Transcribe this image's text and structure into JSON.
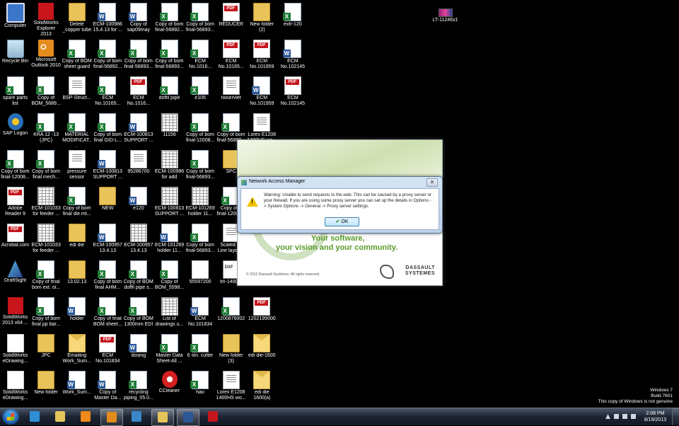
{
  "desktop": {
    "icons": [
      {
        "label": "Computer",
        "kind": "computer",
        "col": 0,
        "row": 0
      },
      {
        "label": "Recycle Bin",
        "kind": "recycle",
        "col": 0,
        "row": 1
      },
      {
        "label": "spare parts list",
        "kind": "excel",
        "col": 0,
        "row": 2
      },
      {
        "label": "SAP Logon",
        "kind": "sap",
        "col": 0,
        "row": 3
      },
      {
        "label": "Copy of bom final-12008...",
        "kind": "excel",
        "col": 0,
        "row": 4
      },
      {
        "label": "Adobe Reader 9",
        "kind": "pdf",
        "col": 0,
        "row": 5
      },
      {
        "label": "Acrobat.com",
        "kind": "pdf",
        "col": 0,
        "row": 6
      },
      {
        "label": "DraftSight",
        "kind": "draft",
        "col": 0,
        "row": 7
      },
      {
        "label": "SolidWorks 2013 x64 ...",
        "kind": "sw",
        "col": 0,
        "row": 8
      },
      {
        "label": "SolidWorks eDrawing...",
        "kind": "edraw",
        "col": 0,
        "row": 9
      },
      {
        "label": "SolidWorks eDrawing...",
        "kind": "edraw",
        "col": 0,
        "row": 10
      },
      {
        "label": "SolidWorks Explorer 2013",
        "kind": "sw",
        "col": 1,
        "row": 0
      },
      {
        "label": "Microsoft Outlook 2010",
        "kind": "outlook",
        "col": 1,
        "row": 1
      },
      {
        "label": "Copy of BOM_5689...",
        "kind": "excel",
        "col": 1,
        "row": 2
      },
      {
        "label": "KRA 12 -13 (JPC)",
        "kind": "excel",
        "col": 1,
        "row": 3
      },
      {
        "label": "Copy of bom final mech...",
        "kind": "excel",
        "col": 1,
        "row": 4
      },
      {
        "label": "ECM-101033 for feeder ...",
        "kind": "table",
        "col": 1,
        "row": 5
      },
      {
        "label": "ECM-101033 for feeder ...",
        "kind": "table",
        "col": 1,
        "row": 6
      },
      {
        "label": "Copy of final bom ext. oi...",
        "kind": "excel",
        "col": 1,
        "row": 7
      },
      {
        "label": "Copy of bom final pp bar...",
        "kind": "excel",
        "col": 1,
        "row": 8
      },
      {
        "label": "JPC",
        "kind": "folder",
        "col": 1,
        "row": 9
      },
      {
        "label": "New folder",
        "kind": "folder",
        "col": 1,
        "row": 10
      },
      {
        "label": "Delete _copper tube",
        "kind": "folder",
        "col": 2,
        "row": 0
      },
      {
        "label": "Copy of BOM sheet guard",
        "kind": "excel",
        "col": 2,
        "row": 1
      },
      {
        "label": "BSP-Struct...",
        "kind": "doc",
        "col": 2,
        "row": 2
      },
      {
        "label": "MATERIAL MODIFICAT...",
        "kind": "excel",
        "col": 2,
        "row": 3
      },
      {
        "label": "pressure sensor",
        "kind": "doc",
        "col": 2,
        "row": 4
      },
      {
        "label": "Copy of bom final die mt...",
        "kind": "excel",
        "col": 2,
        "row": 5
      },
      {
        "label": "edi die",
        "kind": "folder",
        "col": 2,
        "row": 6
      },
      {
        "label": "13.02.13",
        "kind": "folder",
        "col": 2,
        "row": 7
      },
      {
        "label": "holder",
        "kind": "word",
        "col": 2,
        "row": 8
      },
      {
        "label": "Emailing Work_Sum...",
        "kind": "envelope",
        "col": 2,
        "row": 9
      },
      {
        "label": "Work_Sum...",
        "kind": "word",
        "col": 2,
        "row": 10
      },
      {
        "label": "ECM-100986 15.4.13 for ...",
        "kind": "word",
        "col": 3,
        "row": 0
      },
      {
        "label": "Copy of bom final-56892...",
        "kind": "excel",
        "col": 3,
        "row": 1
      },
      {
        "label": "ECM No.10165...",
        "kind": "excel",
        "col": 3,
        "row": 2
      },
      {
        "label": "Copy of bom final GID-L...",
        "kind": "excel",
        "col": 3,
        "row": 3
      },
      {
        "label": "ECM-100813 SUPPORT ...",
        "kind": "word",
        "col": 3,
        "row": 4
      },
      {
        "label": "NEW",
        "kind": "folder",
        "col": 3,
        "row": 5
      },
      {
        "label": "ECM-100957 13.4.13",
        "kind": "word",
        "col": 3,
        "row": 6
      },
      {
        "label": "Copy of bom final AHM...",
        "kind": "excel",
        "col": 3,
        "row": 7
      },
      {
        "label": "Copy of final BOM sheet...",
        "kind": "excel",
        "col": 3,
        "row": 8
      },
      {
        "label": "ECM No.101834",
        "kind": "pdf",
        "col": 3,
        "row": 9
      },
      {
        "label": "Copy of Master Da...",
        "kind": "word",
        "col": 3,
        "row": 10
      },
      {
        "label": "Copy of sap09may",
        "kind": "word",
        "col": 4,
        "row": 0
      },
      {
        "label": "Copy of bom final-56893...",
        "kind": "excel",
        "col": 4,
        "row": 1
      },
      {
        "label": "ECM No.1016...",
        "kind": "pdf",
        "col": 4,
        "row": 2
      },
      {
        "label": "ECM-100813 SUPPORT ...",
        "kind": "word",
        "col": 4,
        "row": 3
      },
      {
        "label": "95286700",
        "kind": "doc",
        "col": 4,
        "row": 4
      },
      {
        "label": "e120",
        "kind": "word",
        "col": 4,
        "row": 5
      },
      {
        "label": "ECM-100957 13.4.13",
        "kind": "table",
        "col": 4,
        "row": 6
      },
      {
        "label": "Copy of BOM doffil pipe s...",
        "kind": "excel",
        "col": 4,
        "row": 7
      },
      {
        "label": "Copy of BOM 1300mm EDI",
        "kind": "excel",
        "col": 4,
        "row": 8
      },
      {
        "label": "dosing",
        "kind": "word",
        "col": 4,
        "row": 9
      },
      {
        "label": "recycling piping_05.0...",
        "kind": "excel",
        "col": 4,
        "row": 10
      },
      {
        "label": "Copy of bom final-56892...",
        "kind": "excel",
        "col": 5,
        "row": 0
      },
      {
        "label": "Copy of bom final-56893...",
        "kind": "excel",
        "col": 5,
        "row": 1
      },
      {
        "label": "doffil pipe",
        "kind": "excel",
        "col": 5,
        "row": 2
      },
      {
        "label": "11156",
        "kind": "table",
        "col": 5,
        "row": 3
      },
      {
        "label": "ECM-100986 for add",
        "kind": "table",
        "col": 5,
        "row": 4
      },
      {
        "label": "ECM-100813 SUPPORT ...",
        "kind": "table",
        "col": 5,
        "row": 5
      },
      {
        "label": "ECM-101269 holder 11...",
        "kind": "word",
        "col": 5,
        "row": 6
      },
      {
        "label": "Copy of BOM_5598...",
        "kind": "excel",
        "col": 5,
        "row": 7
      },
      {
        "label": "List of drawings u...",
        "kind": "table",
        "col": 5,
        "row": 8
      },
      {
        "label": "Master Data Sheet-All ...",
        "kind": "excel",
        "col": 5,
        "row": 9
      },
      {
        "label": "CCleaner",
        "kind": "ccleaner",
        "col": 5,
        "row": 10
      },
      {
        "label": "Copy of bom final-56893...",
        "kind": "excel",
        "col": 6,
        "row": 0
      },
      {
        "label": "ECM No.1016...",
        "kind": "excel",
        "col": 6,
        "row": 1
      },
      {
        "label": "e105",
        "kind": "excel",
        "col": 6,
        "row": 2
      },
      {
        "label": "Copy of bom final-12008...",
        "kind": "excel",
        "col": 6,
        "row": 3
      },
      {
        "label": "Copy of bom final-56893...",
        "kind": "excel",
        "col": 6,
        "row": 4
      },
      {
        "label": "ECM-101269 holder 11...",
        "kind": "table",
        "col": 6,
        "row": 5
      },
      {
        "label": "Copy of bom final-56893...",
        "kind": "excel",
        "col": 6,
        "row": 6
      },
      {
        "label": "55597200",
        "kind": "blank",
        "col": 6,
        "row": 7
      },
      {
        "label": "ECM No.101834",
        "kind": "word",
        "col": 6,
        "row": 8
      },
      {
        "label": "6 stn. cutter",
        "kind": "excel",
        "col": 6,
        "row": 9
      },
      {
        "label": "hao",
        "kind": "excel",
        "col": 6,
        "row": 10
      },
      {
        "label": "REDUCER",
        "kind": "pdf",
        "col": 7,
        "row": 0
      },
      {
        "label": "ECM No.10165...",
        "kind": "pdf",
        "col": 7,
        "row": 1
      },
      {
        "label": "rwservlet",
        "kind": "doc",
        "col": 7,
        "row": 2
      },
      {
        "label": "Copy of bom final-56893...",
        "kind": "excel",
        "col": 7,
        "row": 3
      },
      {
        "label": "SPC",
        "kind": "folder",
        "col": 7,
        "row": 4
      },
      {
        "label": "Copy of b final-12008...",
        "kind": "excel",
        "col": 7,
        "row": 5
      },
      {
        "label": "Scaled Ta Line layou...",
        "kind": "doc",
        "col": 7,
        "row": 6
      },
      {
        "label": "lm-1400...",
        "kind": "bmp",
        "col": 7,
        "row": 7
      },
      {
        "label": "1200876002",
        "kind": "excel",
        "col": 7,
        "row": 8
      },
      {
        "label": "New folder (3)",
        "kind": "folder",
        "col": 7,
        "row": 9
      },
      {
        "label": "Lorex E1208 1400HS wo...",
        "kind": "doc",
        "col": 7,
        "row": 10
      },
      {
        "label": "New folder (2)",
        "kind": "folder",
        "col": 8,
        "row": 0
      },
      {
        "label": "ECM No.101959",
        "kind": "pdf",
        "col": 8,
        "row": 1
      },
      {
        "label": "ECM No.101959",
        "kind": "word",
        "col": 8,
        "row": 2
      },
      {
        "label": "Lorex E1208 1400HS wo...",
        "kind": "doc",
        "col": 8,
        "row": 3
      },
      {
        "label": "support fit...",
        "kind": "doc",
        "col": 8,
        "row": 7
      },
      {
        "label": "1202199000",
        "kind": "pdf",
        "col": 8,
        "row": 8
      },
      {
        "label": "edi die-1600",
        "kind": "envelope",
        "col": 8,
        "row": 9
      },
      {
        "label": "edi die 1600(a)",
        "kind": "envelope",
        "col": 8,
        "row": 10
      },
      {
        "label": "extr-120",
        "kind": "excel",
        "col": 9,
        "row": 0
      },
      {
        "label": "ECM No.102145",
        "kind": "word",
        "col": 9,
        "row": 1
      },
      {
        "label": "ECM No.102145",
        "kind": "pdf",
        "col": 9,
        "row": 2
      }
    ],
    "extra_icon": {
      "label": "LT-11246x1",
      "kind": "rar"
    }
  },
  "splash": {
    "tagline_line1": "Your software,",
    "tagline_line2": "your vision and your community.",
    "copyright": "© 2012 Dassault Systèmes. All rights reserved.",
    "brand_line1": "DASSAULT",
    "brand_line2": "SYSTEMES"
  },
  "dialog": {
    "title": "Network Access Manager",
    "close_glyph": "✕",
    "message": "Warning: Unable to send requests to the web. This can be caused by a proxy server or your firewall. If you are using some proxy server you can set up the details in Options -> System Options -> General -> Proxy server settings.",
    "ok_label": "OK"
  },
  "taskbar": {
    "apps": [
      {
        "name": "internet-explorer",
        "color": "#2f8fd8",
        "active": false
      },
      {
        "name": "windows-explorer",
        "color": "#e6c45c",
        "active": false
      },
      {
        "name": "media-player",
        "color": "#f08a1a",
        "active": false
      },
      {
        "name": "outlook",
        "color": "#e38b1c",
        "active": true
      },
      {
        "name": "draftsight",
        "color": "#3a86c8",
        "active": false
      },
      {
        "name": "folder",
        "color": "#e6c45c",
        "active": true
      },
      {
        "name": "word",
        "color": "#2b5797",
        "active": true
      },
      {
        "name": "adobe-reader",
        "color": "#c4161c",
        "active": false
      }
    ],
    "time": "2:08 PM",
    "date": "8/19/2013"
  },
  "watermark": {
    "line1": "Windows 7",
    "line2": "Build 7601",
    "line3": "This copy of Windows is not genuine"
  }
}
